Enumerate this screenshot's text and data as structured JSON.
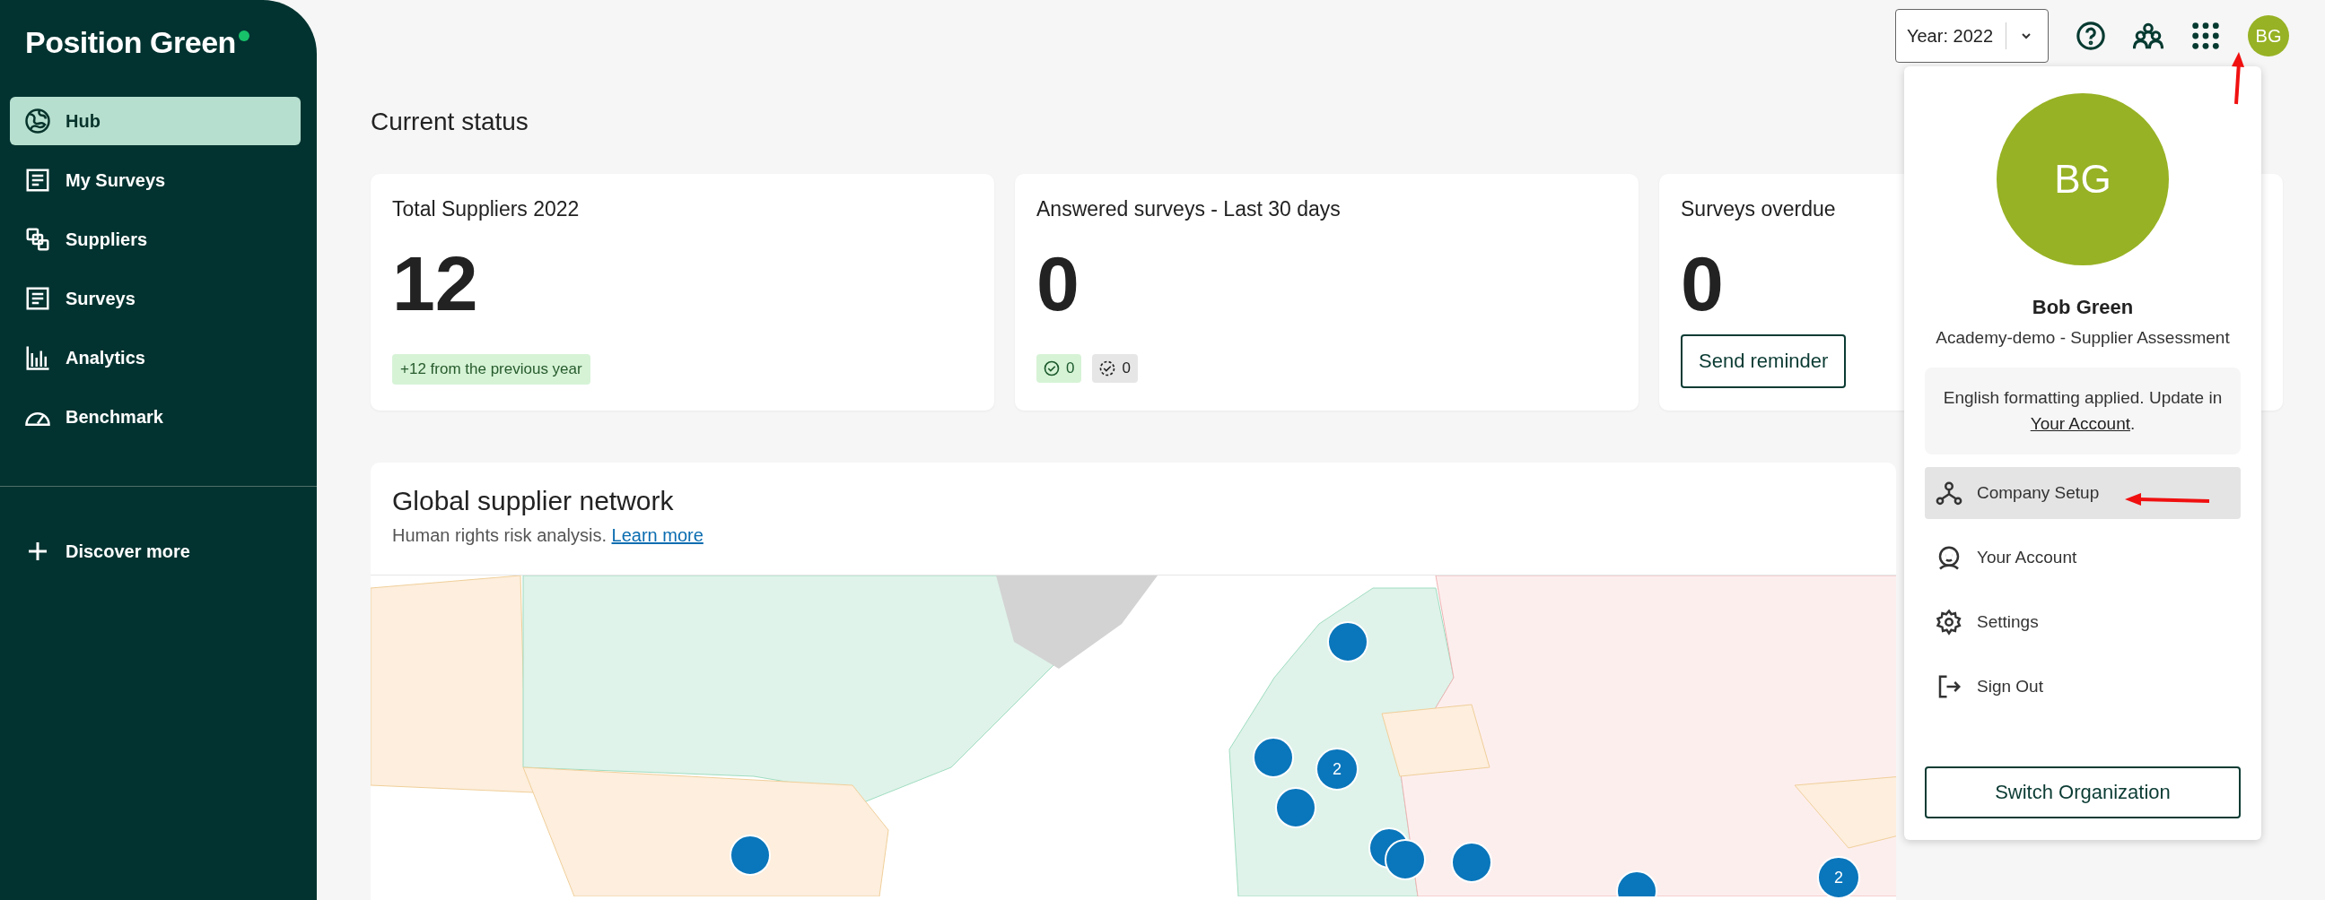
{
  "brand": {
    "name": "Position Green"
  },
  "sidebar": {
    "items": [
      {
        "label": "Hub",
        "selected": true
      },
      {
        "label": "My Surveys",
        "selected": false
      },
      {
        "label": "Suppliers",
        "selected": false
      },
      {
        "label": "Surveys",
        "selected": false
      },
      {
        "label": "Analytics",
        "selected": false
      },
      {
        "label": "Benchmark",
        "selected": false
      }
    ],
    "discover": "Discover more"
  },
  "topbar": {
    "year_select": "Year: 2022",
    "avatar": "BG"
  },
  "page_title": "Current status",
  "cards": [
    {
      "kind": "trend",
      "title": "Total Suppliers 2022",
      "value": "12",
      "note": "+12 from the previous year"
    },
    {
      "kind": "counts",
      "title": "Answered surveys - Last 30 days",
      "value": "0",
      "counts": [
        "0",
        "0"
      ]
    },
    {
      "kind": "action",
      "title": "Surveys overdue",
      "value": "0",
      "button": "Send reminder"
    }
  ],
  "network": {
    "title": "Global supplier network",
    "subtitle": "Human rights risk analysis.",
    "link": "Learn more",
    "cluster_counts": [
      "2",
      "2"
    ]
  },
  "profile_menu": {
    "avatar": "BG",
    "name": "Bob Green",
    "org": "Academy-demo - Supplier Assessment",
    "notice": {
      "text": "English formatting applied. Update in",
      "link": "Your Account",
      "end": "."
    },
    "items": [
      {
        "label": "Company Setup",
        "selected": true
      },
      {
        "label": "Your Account",
        "selected": false
      },
      {
        "label": "Settings",
        "selected": false
      },
      {
        "label": "Sign Out",
        "selected": false
      }
    ],
    "switch_button": "Switch Organization"
  }
}
